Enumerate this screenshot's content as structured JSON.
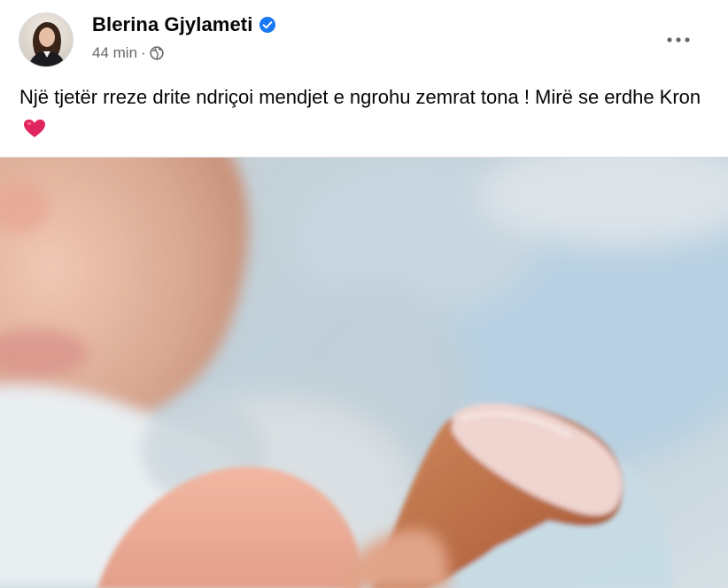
{
  "post": {
    "author": {
      "name": "Blerina Gjylameti",
      "verified": true,
      "verified_icon": "verified-badge-icon",
      "avatar_icon": "profile-avatar"
    },
    "meta": {
      "timestamp": "44 min",
      "separator": "·",
      "audience_icon": "globe-icon"
    },
    "menu_icon": "more-options-icon",
    "caption": {
      "text": "Një tjetër rreze drite ndriçoi mendjet e ngrohu zemrat tona ! Mirë se erdhe Kron",
      "emoji_icon": "red-heart-emoji"
    },
    "photo": {
      "subject": "newborn-holding-finger-photo"
    },
    "colors": {
      "verified_blue": "#1877f2",
      "secondary_text": "#65676b",
      "primary_text": "#050505",
      "heart_red": "#e0245e"
    }
  }
}
